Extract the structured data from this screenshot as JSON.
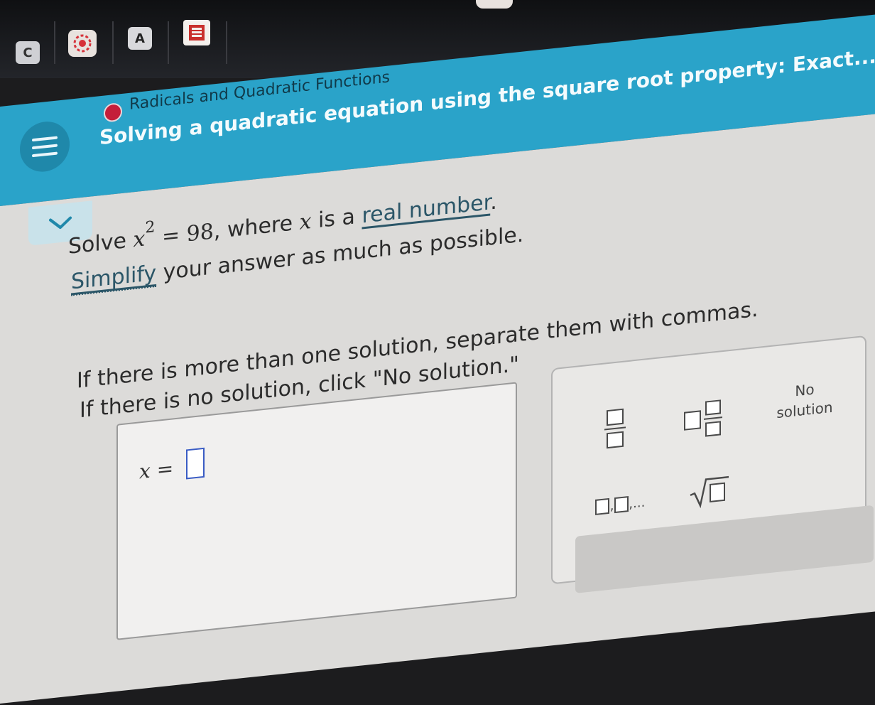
{
  "browser": {
    "tabs": [
      {
        "icon": "c-letter-icon",
        "label": "C"
      },
      {
        "icon": "snowflake-logo-icon",
        "label": ""
      },
      {
        "icon": "a-letter-icon",
        "label": "A"
      },
      {
        "icon": "red-book-icon",
        "label": ""
      }
    ]
  },
  "header": {
    "topic": "Radicals and Quadratic Functions",
    "title": "Solving a quadratic equation using the square root property: Exact...",
    "accent_color": "#2aa3c9",
    "status_dot_color": "#c41e3a"
  },
  "question": {
    "solve_word": "Solve",
    "var": "x",
    "exponent": "2",
    "equation_rhs": "= 98",
    "where_text": ", where",
    "var2": "x",
    "is_a": " is a",
    "real_number_link": "real number",
    "period": ".",
    "simplify_link": "Simplify",
    "simplify_rest": " your answer as much as possible.",
    "instruction_1": "If there is more than one solution, separate them with commas.",
    "instruction_2": "If there is no solution, click \"No solution.\""
  },
  "answer": {
    "label": "x =",
    "value": ""
  },
  "keypad": {
    "keys": [
      "fraction",
      "mixed-number",
      "list",
      "square-root"
    ],
    "list_ellipsis": ",...",
    "no_solution_line1": "No",
    "no_solution_line2": "solution"
  }
}
